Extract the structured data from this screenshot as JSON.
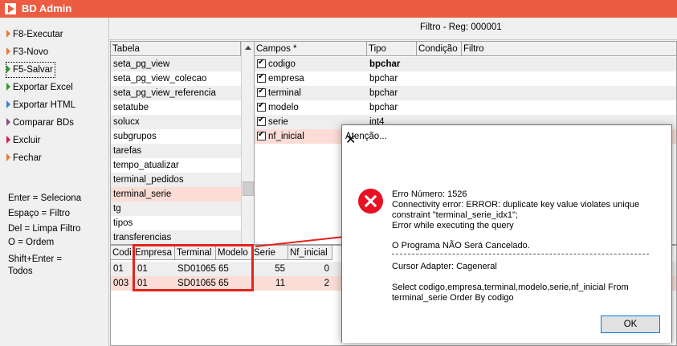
{
  "app": {
    "title": "BD Admin"
  },
  "sidebar": {
    "menu": [
      {
        "label": "F8-Executar",
        "color": "#e87a3c"
      },
      {
        "label": "F3-Novo",
        "color": "#e87a3c"
      },
      {
        "label": "F5-Salvar",
        "color": "#2e9a2e"
      },
      {
        "label": "Exportar Excel",
        "color": "#2e9a2e"
      },
      {
        "label": "Exportar HTML",
        "color": "#3a7fd0"
      },
      {
        "label": "Comparar BDs",
        "color": "#8a4a8a"
      },
      {
        "label": "Excluir",
        "color": "#d02050"
      },
      {
        "label": "Fechar",
        "color": "#e87a3c"
      }
    ],
    "hints": [
      "Enter = Seleciona",
      "Espaço = Filtro",
      "Del = Limpa Filtro",
      "O  =  Ordem",
      "Shift+Enter =",
      "Todos"
    ]
  },
  "filter_title": "Filtro - Reg: 000001",
  "tables_grid": {
    "header": "Tabela",
    "rows": [
      "seta_pg_view",
      "seta_pg_view_colecao",
      "seta_pg_view_referencia",
      "setatube",
      "solucx",
      "subgrupos",
      "tarefas",
      "tempo_atualizar",
      "terminal_pedidos",
      "terminal_serie",
      "tg",
      "tipos",
      "transferencias"
    ],
    "selected": "terminal_serie"
  },
  "fields_grid": {
    "headers": [
      "Campos *",
      "Tipo",
      "Condição",
      "Filtro"
    ],
    "rows": [
      {
        "campo": "codigo",
        "tipo": "bpchar"
      },
      {
        "campo": "empresa",
        "tipo": "bpchar"
      },
      {
        "campo": "terminal",
        "tipo": "bpchar"
      },
      {
        "campo": "modelo",
        "tipo": "bpchar"
      },
      {
        "campo": "serie",
        "tipo": "int4"
      },
      {
        "campo": "nf_inicial",
        "tipo": ""
      }
    ]
  },
  "data_grid": {
    "headers": [
      "Codi",
      "Empresa",
      "Terminal",
      "Modelo",
      "Serie",
      "Nf_inicial"
    ],
    "rows": [
      [
        "01",
        "01",
        "SD01065",
        "65",
        "55",
        "0"
      ],
      [
        "003",
        "01",
        "SD01065",
        "65",
        "11",
        "2"
      ]
    ]
  },
  "dialog": {
    "title": "Atenção...",
    "close": "✕",
    "lines": [
      "Erro Número: 1526",
      "Connectivity error: ERROR: duplicate key value violates unique",
      "constraint \"terminal_serie_idx1\";",
      "Error while executing the query",
      "O Programa NÃO Será Cancelado.",
      "Cursor Adapter: Cageneral",
      "Select codigo,empresa,terminal,modelo,serie,nf_inicial From",
      "terminal_serie  Order By codigo"
    ],
    "ok": "OK"
  },
  "colors": {
    "titlebar": "#ec5c42",
    "selected_row": "#fbdcd6",
    "highlight": "#e8221c"
  }
}
